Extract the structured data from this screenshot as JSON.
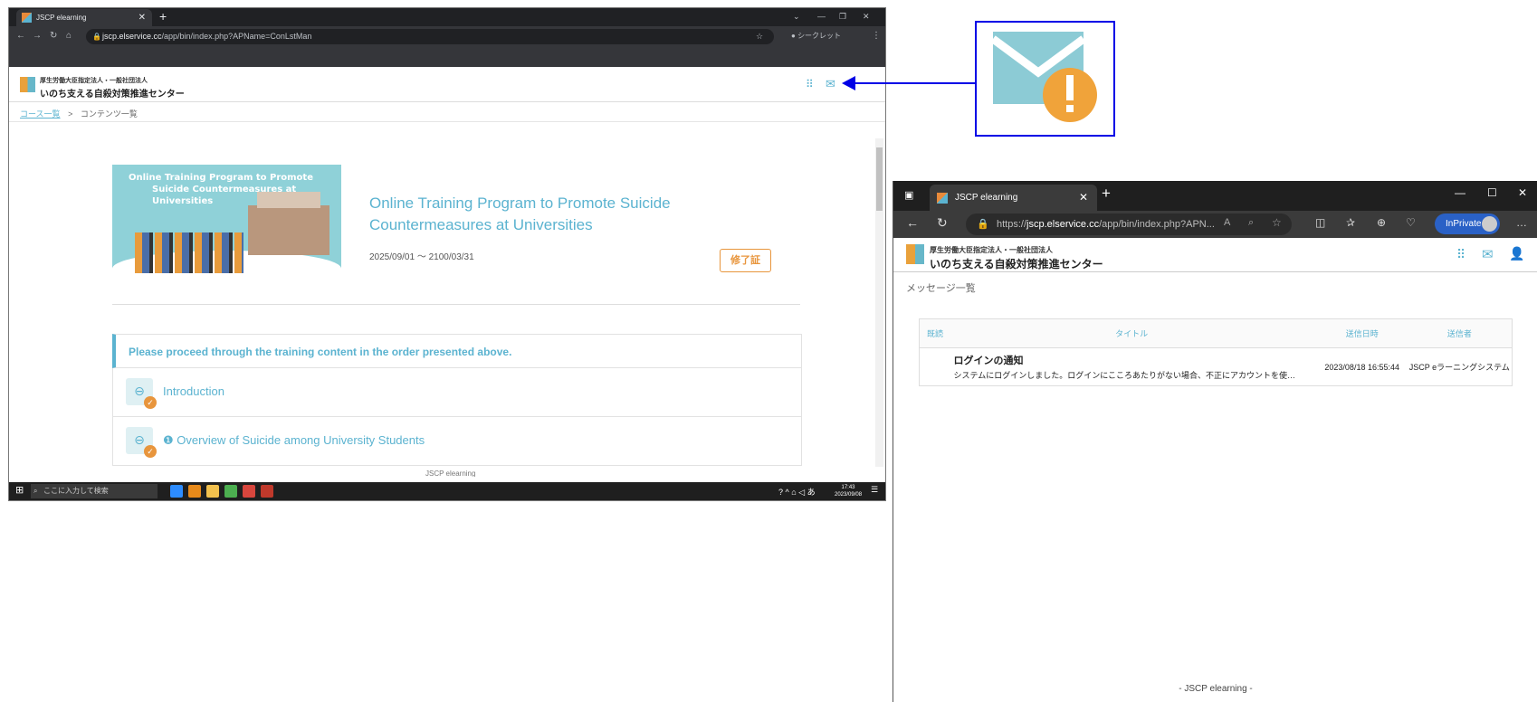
{
  "left_window": {
    "tab_title": "JSCP elearning",
    "tab_close": "✕",
    "new_tab": "+",
    "url_host": "jscp.elservice.cc",
    "url_path": "/app/bin/index.php?APName=ConLstMan",
    "profile": "シークレット",
    "org_sub": "厚生労働大臣指定法人・一般社団法人",
    "org_name": "いのち支える自殺対策推進センター",
    "breadcrumb_link": "コース一覧",
    "breadcrumb_sep": ">",
    "breadcrumb_current": "コンテンツ一覧",
    "banner_line1": "Online Training Program to Promote",
    "banner_line2": "Suicide Countermeasures at Universities",
    "course_title": "Online Training Program to Promote Suicide Countermeasures at Universities",
    "course_dates": "2025/09/01 〜 2100/03/31",
    "certificate_button": "修了証",
    "notice": "Please proceed through the training content in the order presented above.",
    "contents": [
      {
        "label": "Introduction"
      },
      {
        "label": "❶ Overview of Suicide among University Students"
      }
    ],
    "footer_partial": "JSCP elearning",
    "taskbar_search": "ここに入力して検索",
    "clock_time": "17:43",
    "clock_date": "2023/09/08"
  },
  "right_window": {
    "tab_title": "JSCP elearning",
    "tab_close": "✕",
    "new_tab": "+",
    "url_scheme": "https://",
    "url_host": "jscp.elservice.cc",
    "url_path": "/app/bin/index.php?APN...",
    "inprivate": "InPrivate",
    "org_sub": "厚生労働大臣指定法人・一般社団法人",
    "org_name": "いのち支える自殺対策推進センター",
    "page_title": "メッセージ一覧",
    "table_headers": {
      "read": "既読",
      "title": "タイトル",
      "sent": "送信日時",
      "sender": "送信者"
    },
    "messages": [
      {
        "title": "ログインの通知",
        "body": "システムにログインしました。ログインにこころあたりがない場合、不正にアカウントを使…",
        "sent": "2023/08/18 16:55:44",
        "sender": "JSCP eラーニングシステム"
      }
    ],
    "footer": "- JSCP elearning -"
  },
  "colors": {
    "accent": "#5bb3d0",
    "orange": "#e8953c",
    "callout": "#0000e6"
  }
}
